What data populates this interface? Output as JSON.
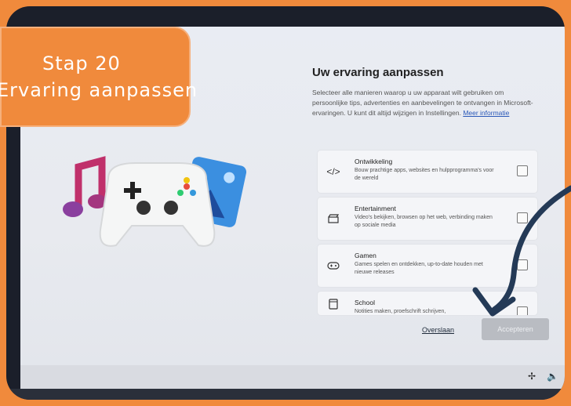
{
  "label": {
    "line1": "Stap 20",
    "line2": "Ervaring aanpassen"
  },
  "dialog": {
    "title": "Uw ervaring aanpassen",
    "description": "Selecteer alle manieren waarop u uw apparaat wilt gebruiken om persoonlijke tips, advertenties en aanbevelingen te ontvangen in Microsoft-ervaringen. U kunt dit altijd wijzigen in Instellingen.",
    "more_link": "Meer informatie",
    "options": [
      {
        "title": "Ontwikkeling",
        "desc": "Bouw prachtige apps, websites en hulpprogramma's voor de wereld",
        "icon": "code-icon"
      },
      {
        "title": "Entertainment",
        "desc": "Video's bekijken, browsen op het web, verbinding maken op sociale media",
        "icon": "clapperboard-icon"
      },
      {
        "title": "Gamen",
        "desc": "Games spelen en ontdekken, up-to-date houden met nieuwe releases",
        "icon": "gamepad-icon"
      },
      {
        "title": "School",
        "desc": "Notities maken, proefschrift schrijven,",
        "icon": "notebook-icon"
      }
    ],
    "skip_label": "Overslaan",
    "accept_label": "Accepteren"
  },
  "colors": {
    "orange": "#f08a3c",
    "arrow": "#243a57",
    "accept_disabled": "#b9bcc2"
  }
}
